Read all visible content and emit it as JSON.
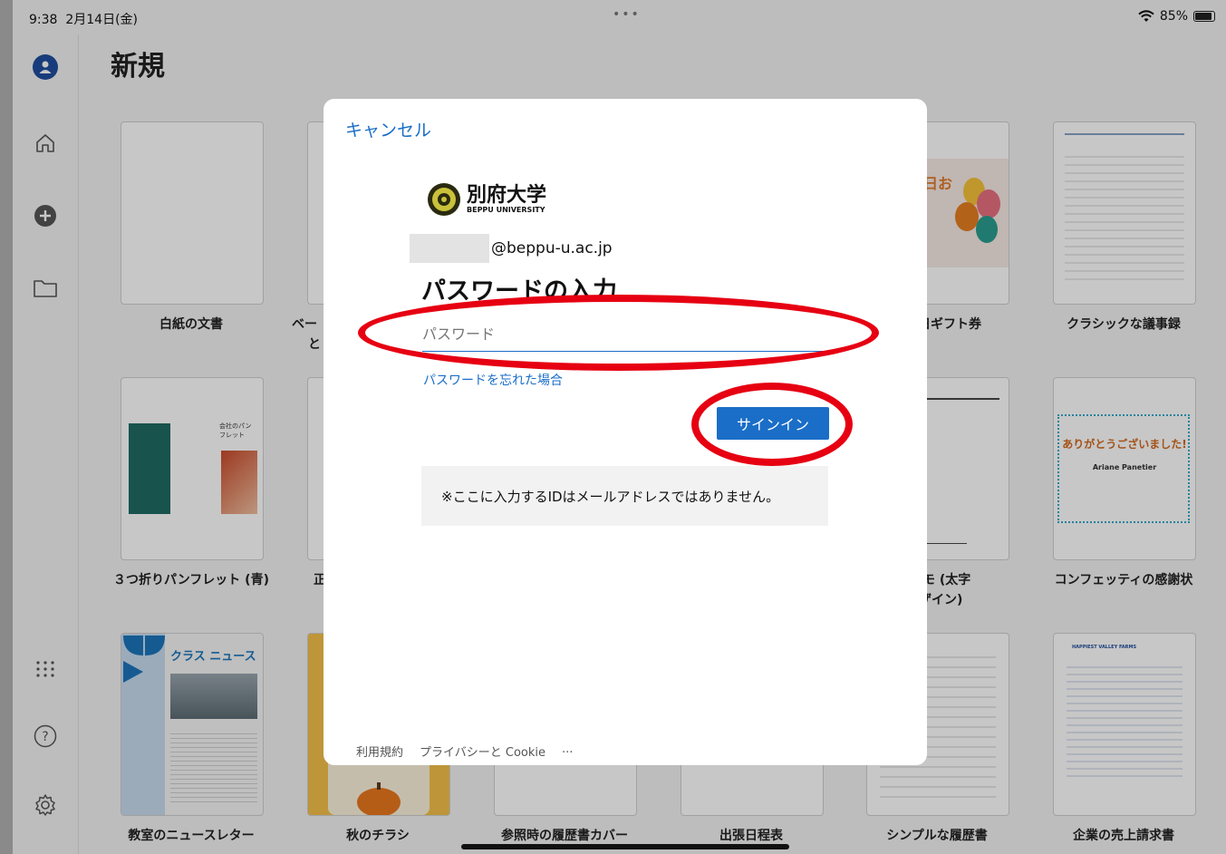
{
  "status": {
    "time": "9:38",
    "date": "2月14日(金)",
    "battery": "85%",
    "dots": "•••"
  },
  "page": {
    "title": "新規"
  },
  "templates": [
    {
      "label": "白紙の文書"
    },
    {
      "label": "ベー"
    },
    {
      "label": "と"
    },
    {
      "label": "生日ギフト券"
    },
    {
      "label": "クラシックな議事録"
    },
    {
      "label": "３つ折りパンフレット (青)"
    },
    {
      "label": "正"
    },
    {
      "label": "メモ (太字"
    },
    {
      "label": "ザイン)"
    },
    {
      "label": "コンフェッティの感謝状"
    },
    {
      "label": "教室のニュースレター"
    },
    {
      "label": "秋のチラシ"
    },
    {
      "label": "参照時の履歴書カバー"
    },
    {
      "label": "出張日程表"
    },
    {
      "label": "シンプルな履歴書"
    },
    {
      "label": "企業の売上請求書"
    }
  ],
  "thumbs": {
    "newsletter_title": "クラス ニュース",
    "thanks_title": "ありがとうございました!",
    "thanks_name": "Ariane Panetier",
    "invoice_title": "HAPPIEST VALLEY FARMS",
    "gift_text": "日お",
    "pamphlet_text": "会社のパンフレット"
  },
  "modal": {
    "cancel": "キャンセル",
    "org_name": "別府大学",
    "org_sub": "BEPPU UNIVERSITY",
    "email_suffix": "@beppu-u.ac.jp",
    "heading": "パスワードの入力",
    "password_placeholder": "パスワード",
    "forgot": "パスワードを忘れた場合",
    "signin": "サインイン",
    "notice": "※ここに入力するIDはメールアドレスではありません。",
    "footer": {
      "terms": "利用規約",
      "privacy": "プライバシーと Cookie",
      "more": "..."
    }
  },
  "colors": {
    "accent": "#1a6ec8",
    "annotation": "#e60012",
    "avatar": "#1f4e9e"
  }
}
